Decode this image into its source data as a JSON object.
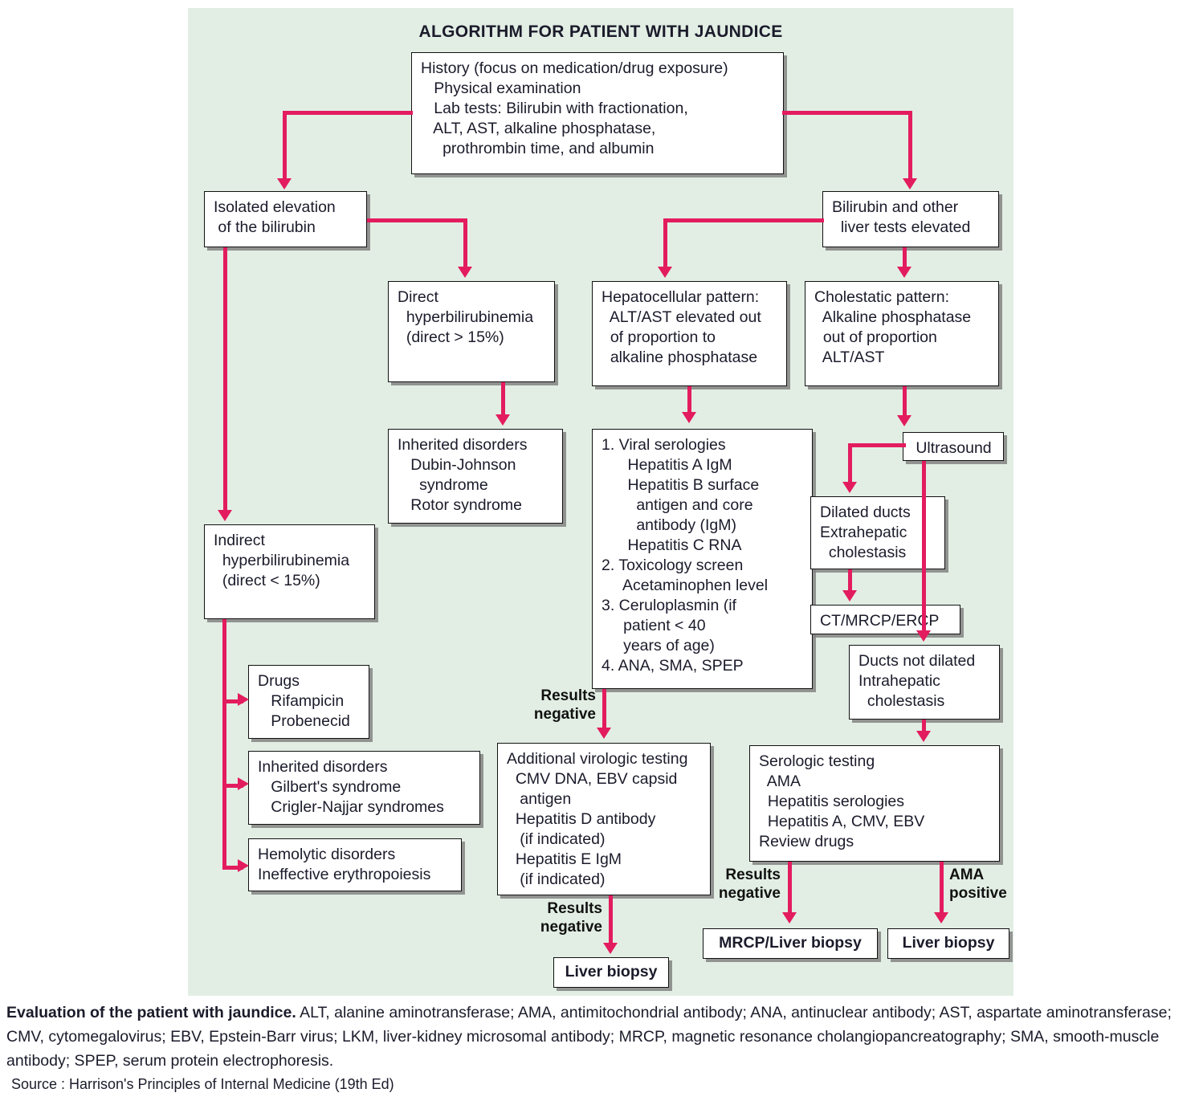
{
  "title": "ALGORITHM FOR PATIENT WITH JAUNDICE",
  "colors": {
    "panel_background": "#e2eee4",
    "connector": "#e31c5f",
    "box_fill": "#ffffff",
    "box_border": "#111111",
    "text": "#1b1b2b"
  },
  "nodes": {
    "history": "History (focus on medication/drug exposure)\n   Physical examination\n   Lab tests: Bilirubin with fractionation,\n   ALT, AST, alkaline phosphatase,\n     prothrombin time, and albumin",
    "isolated_bilirubin": "Isolated elevation\n of the bilirubin",
    "bilirubin_other_tests": "Bilirubin and other\n  liver tests elevated",
    "direct_hyperbilirubinemia": "Direct\n  hyperbilirubinemia\n  (direct > 15%)",
    "hepatocellular_pattern": "Hepatocellular pattern:\n  ALT/AST elevated out\n  of proportion to\n  alkaline phosphatase",
    "cholestatic_pattern": "Cholestatic pattern:\n  Alkaline phosphatase\n  out of proportion\n  ALT/AST",
    "inherited_direct": "Inherited disorders\n   Dubin-Johnson\n     syndrome\n   Rotor syndrome",
    "viral_serologies": "1. Viral serologies\n      Hepatitis A IgM\n      Hepatitis B surface\n        antigen and core\n        antibody (IgM)\n      Hepatitis C RNA\n2. Toxicology screen\n     Acetaminophen level\n3. Ceruloplasmin (if\n     patient < 40\n     years of age)\n4. ANA, SMA, SPEP",
    "ultrasound": "Ultrasound",
    "dilated_ducts": "Dilated ducts\nExtrahepatic\n  cholestasis",
    "ct_mrcp_ercp": "CT/MRCP/ERCP",
    "ducts_not_dilated": "Ducts not dilated\nIntrahepatic\n  cholestasis",
    "indirect_hyperbilirubinemia": "Indirect\n  hyperbilirubinemia\n  (direct < 15%)",
    "drugs": "Drugs\n   Rifampicin\n   Probenecid",
    "inherited_indirect": "Inherited disorders\n   Gilbert's syndrome\n   Crigler-Najjar syndromes",
    "hemolytic": "Hemolytic disorders\nIneffective erythropoiesis",
    "additional_virologic": "Additional virologic testing\n  CMV DNA, EBV capsid\n   antigen\n  Hepatitis D antibody\n   (if indicated)\n  Hepatitis E IgM\n   (if indicated)",
    "serologic_testing": "Serologic testing\n  AMA\n  Hepatitis serologies\n  Hepatitis A, CMV, EBV\nReview drugs",
    "liver_biopsy_center": "Liver biopsy",
    "mrcp_liver_biopsy": "MRCP/Liver biopsy",
    "liver_biopsy_right": "Liver biopsy"
  },
  "edge_labels": {
    "results_negative_1": "Results\nnegative",
    "results_negative_2": "Results\nnegative",
    "results_negative_3": "Results\nnegative",
    "ama_positive": "AMA\npositive"
  },
  "caption": {
    "lead": "Evaluation of the patient with jaundice.",
    "body": " ALT, alanine aminotransferase; AMA, antimitochondrial antibody; ANA, antinuclear antibody; AST, aspartate aminotransferase; CMV, cytomegalovirus; EBV, Epstein-Barr virus; LKM, liver-kidney microsomal antibody; MRCP, magnetic resonance cholangiopancreatography; SMA, smooth-muscle antibody; SPEP, serum protein electrophoresis.",
    "source": "Source : Harrison's Principles of Internal Medicine (19th Ed)"
  }
}
